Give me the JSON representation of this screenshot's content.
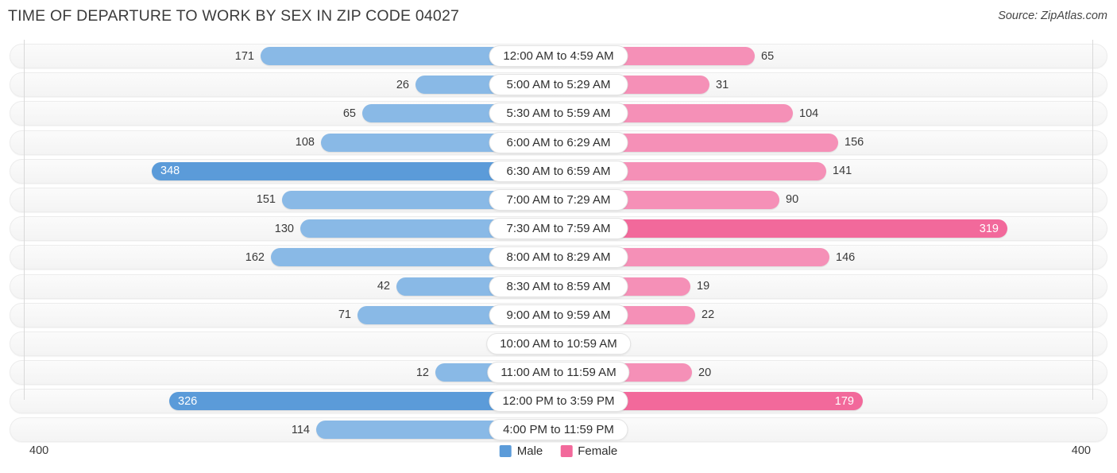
{
  "header": {
    "title": "TIME OF DEPARTURE TO WORK BY SEX IN ZIP CODE 04027",
    "source": "Source: ZipAtlas.com"
  },
  "legend": {
    "male_label": "Male",
    "female_label": "Female",
    "male_color": "#5b9bd9",
    "female_color": "#f2699b"
  },
  "axis": {
    "left_tick": "400",
    "right_tick": "400"
  },
  "chart_data": {
    "type": "bar",
    "orientation": "horizontal-diverging",
    "title": "TIME OF DEPARTURE TO WORK BY SEX IN ZIP CODE 04027",
    "xlabel": "",
    "ylabel": "",
    "xlim": [
      400,
      400
    ],
    "grid": false,
    "legend_position": "bottom-center",
    "categories": [
      "12:00 AM to 4:59 AM",
      "5:00 AM to 5:29 AM",
      "5:30 AM to 5:59 AM",
      "6:00 AM to 6:29 AM",
      "6:30 AM to 6:59 AM",
      "7:00 AM to 7:29 AM",
      "7:30 AM to 7:59 AM",
      "8:00 AM to 8:29 AM",
      "8:30 AM to 8:59 AM",
      "9:00 AM to 9:59 AM",
      "10:00 AM to 10:59 AM",
      "11:00 AM to 11:59 AM",
      "12:00 PM to 3:59 PM",
      "4:00 PM to 11:59 PM"
    ],
    "series": [
      {
        "name": "Male",
        "color": "#89b9e6",
        "highlight_color": "#5b9bd9",
        "values": [
          171,
          26,
          65,
          108,
          348,
          151,
          130,
          162,
          42,
          71,
          0,
          12,
          326,
          114
        ]
      },
      {
        "name": "Female",
        "color": "#f590b7",
        "highlight_color": "#f2699b",
        "values": [
          65,
          31,
          104,
          156,
          141,
          90,
          319,
          146,
          19,
          22,
          0,
          20,
          179,
          0
        ]
      }
    ]
  },
  "rows": [
    {
      "label": "12:00 AM to 4:59 AM",
      "male": "171",
      "female": "65",
      "male_w": 375,
      "female_w": 247,
      "male_hi": false,
      "female_hi": false
    },
    {
      "label": "5:00 AM to 5:29 AM",
      "male": "26",
      "female": "31",
      "male_w": 180,
      "female_w": 190,
      "male_hi": false,
      "female_hi": false
    },
    {
      "label": "5:30 AM to 5:59 AM",
      "male": "65",
      "female": "104",
      "male_w": 247,
      "female_w": 295,
      "male_hi": false,
      "female_hi": false
    },
    {
      "label": "6:00 AM to 6:29 AM",
      "male": "108",
      "female": "156",
      "male_w": 299,
      "female_w": 352,
      "male_hi": false,
      "female_hi": false
    },
    {
      "label": "6:30 AM to 6:59 AM",
      "male": "348",
      "female": "141",
      "male_w": 512,
      "female_w": 337,
      "male_hi": true,
      "female_hi": false
    },
    {
      "label": "7:00 AM to 7:29 AM",
      "male": "151",
      "female": "90",
      "male_w": 348,
      "female_w": 278,
      "male_hi": false,
      "female_hi": false
    },
    {
      "label": "7:30 AM to 7:59 AM",
      "male": "130",
      "female": "319",
      "male_w": 325,
      "female_w": 565,
      "male_hi": false,
      "female_hi": true
    },
    {
      "label": "8:00 AM to 8:29 AM",
      "male": "162",
      "female": "146",
      "male_w": 362,
      "female_w": 341,
      "male_hi": false,
      "female_hi": false
    },
    {
      "label": "8:30 AM to 8:59 AM",
      "male": "42",
      "female": "19",
      "male_w": 204,
      "female_w": 166,
      "male_hi": false,
      "female_hi": false
    },
    {
      "label": "9:00 AM to 9:59 AM",
      "male": "71",
      "female": "22",
      "male_w": 253,
      "female_w": 172,
      "male_hi": false,
      "female_hi": false
    },
    {
      "label": "10:00 AM to 10:59 AM",
      "male": "0",
      "female": "0",
      "male_w": 60,
      "female_w": 60,
      "male_hi": false,
      "female_hi": false
    },
    {
      "label": "11:00 AM to 11:59 AM",
      "male": "12",
      "female": "20",
      "male_w": 155,
      "female_w": 168,
      "male_hi": false,
      "female_hi": false
    },
    {
      "label": "12:00 PM to 3:59 PM",
      "male": "326",
      "female": "179",
      "male_w": 490,
      "female_w": 383,
      "male_hi": true,
      "female_hi": true
    },
    {
      "label": "4:00 PM to 11:59 PM",
      "male": "114",
      "female": "0",
      "male_w": 305,
      "female_w": 60,
      "male_hi": false,
      "female_hi": false
    }
  ]
}
